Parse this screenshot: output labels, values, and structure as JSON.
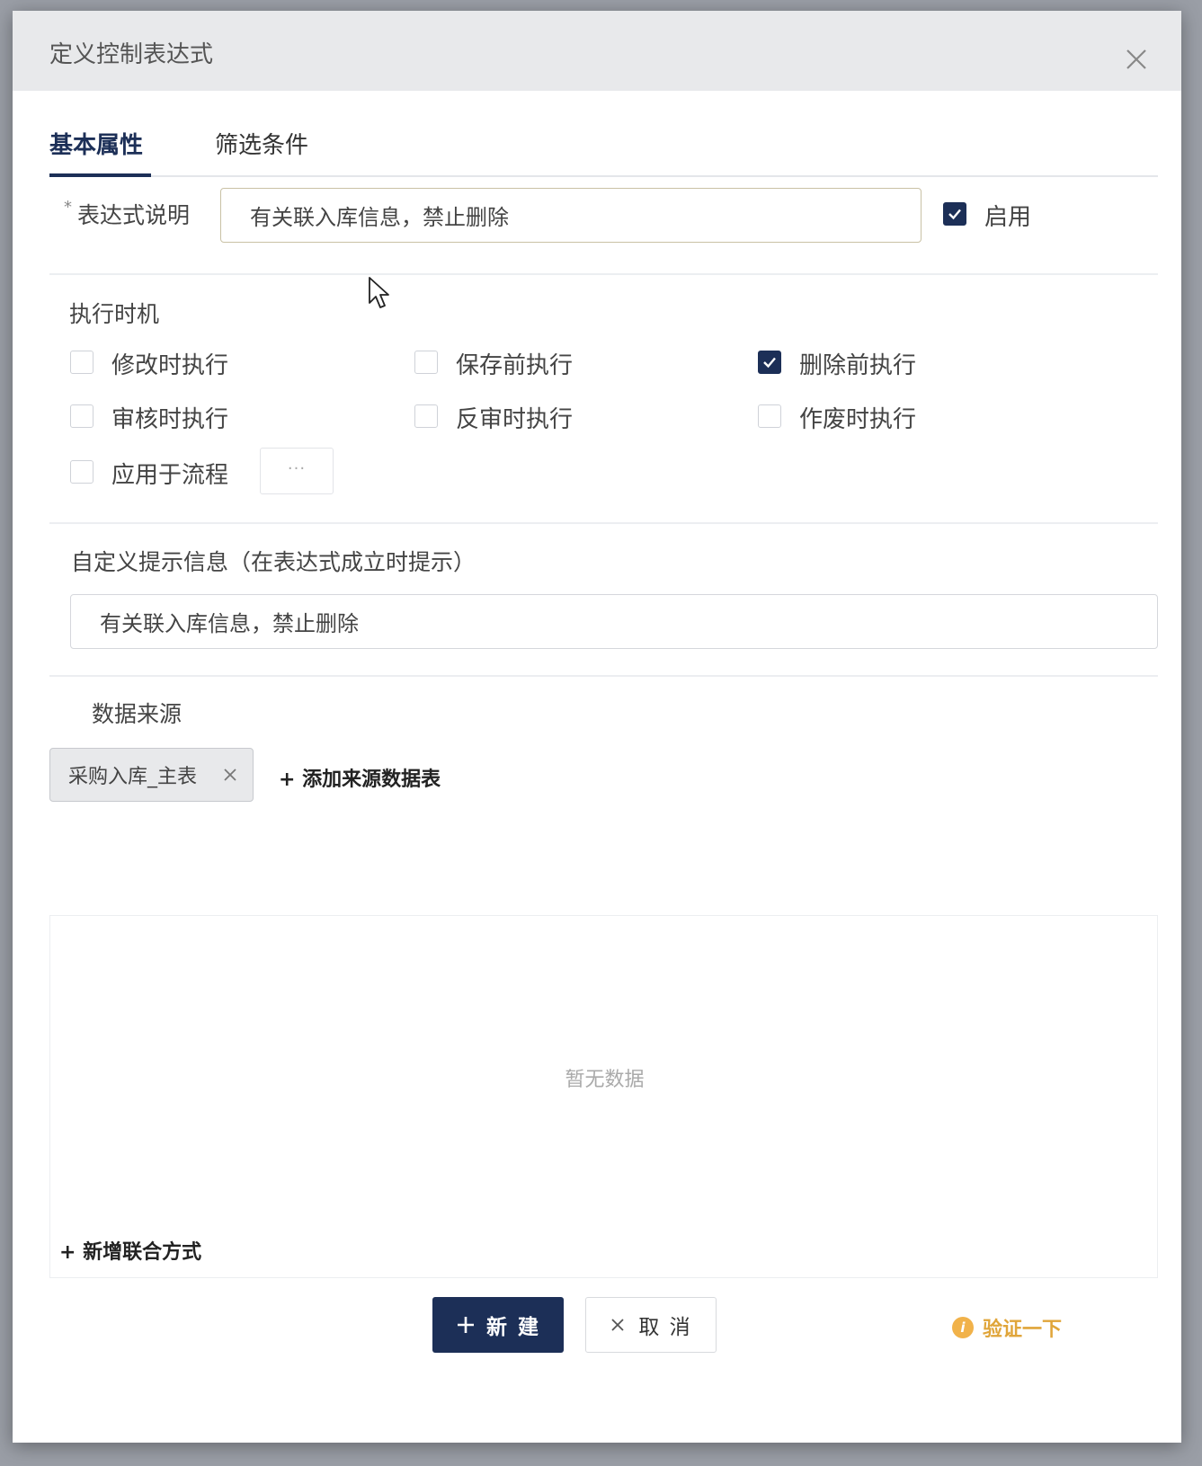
{
  "dialog": {
    "title": "定义控制表达式",
    "tabs": [
      {
        "label": "基本属性",
        "active": true
      },
      {
        "label": "筛选条件",
        "active": false
      }
    ]
  },
  "expression": {
    "label": "表达式说明",
    "required_mark": "*",
    "value": "有关联入库信息，禁止删除",
    "enabled_label": "启用",
    "enabled": true
  },
  "timing": {
    "section_label": "执行时机",
    "options": [
      {
        "label": "修改时执行",
        "checked": false
      },
      {
        "label": "保存前执行",
        "checked": false
      },
      {
        "label": "删除前执行",
        "checked": true
      },
      {
        "label": "审核时执行",
        "checked": false
      },
      {
        "label": "反审时执行",
        "checked": false
      },
      {
        "label": "作废时执行",
        "checked": false
      },
      {
        "label": "应用于流程",
        "checked": false
      }
    ],
    "more_label": "···"
  },
  "prompt": {
    "label": "自定义提示信息（在表达式成立时提示）",
    "value": "有关联入库信息，禁止删除"
  },
  "data_source": {
    "label": "数据来源",
    "tags": [
      "采购入库_主表"
    ],
    "add_label": "+ 添加来源数据表"
  },
  "join": {
    "empty_text": "暂无数据",
    "add_label": "+ 新增联合方式"
  },
  "footer": {
    "new_label": "新 建",
    "new_icon": "plus-icon",
    "cancel_label": "取 消",
    "cancel_icon": "close-icon",
    "verify_label": "验证一下",
    "verify_icon": "info-icon"
  },
  "colors": {
    "primary": "#1c2f57",
    "verify": "#e0a53a"
  }
}
